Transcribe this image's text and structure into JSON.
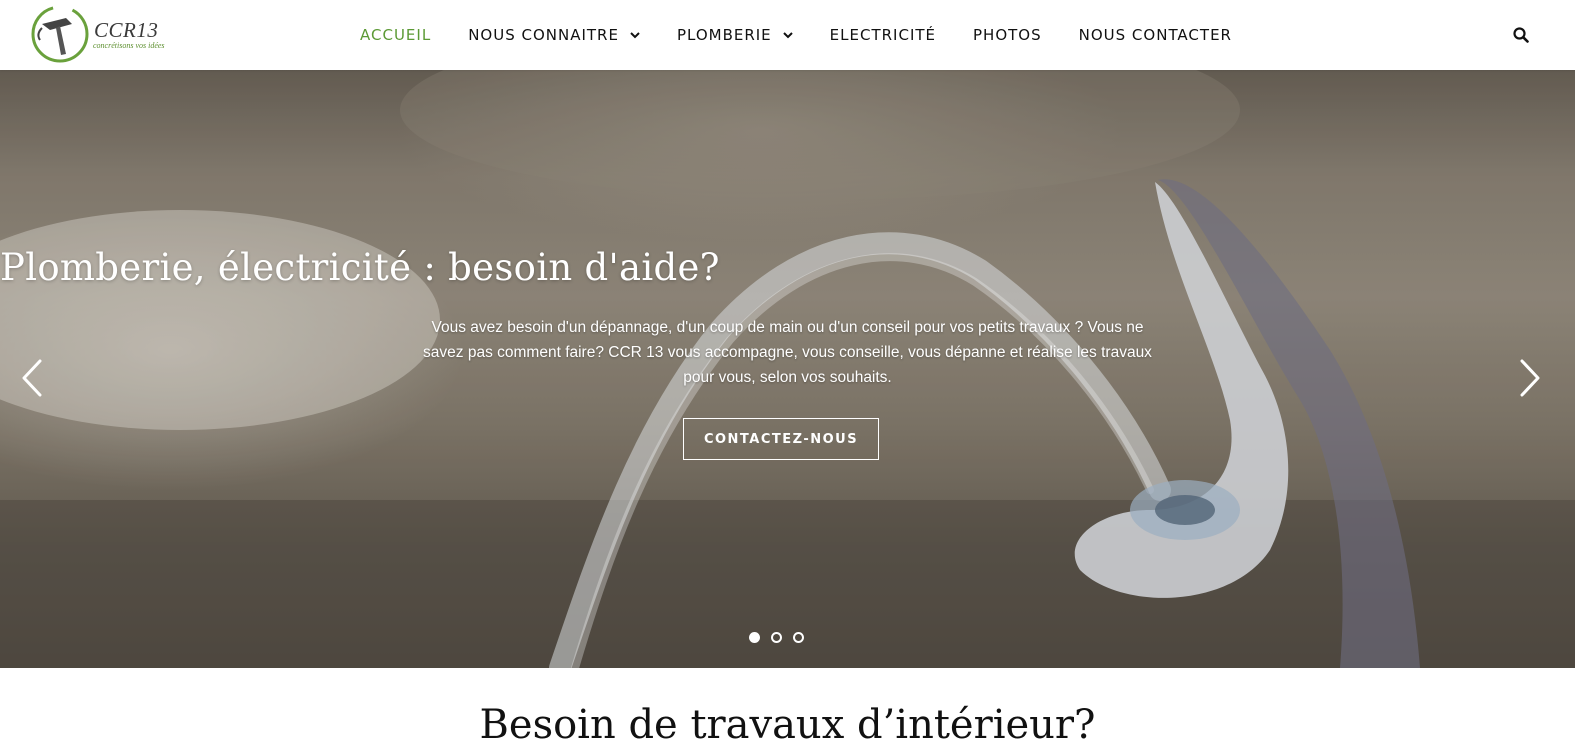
{
  "header": {
    "logo": {
      "name": "CCR13",
      "tagline": "concrétisons vos idées"
    },
    "nav": [
      {
        "label": "ACCUEIL",
        "active": true,
        "has_dropdown": false
      },
      {
        "label": "NOUS CONNAITRE",
        "active": false,
        "has_dropdown": true
      },
      {
        "label": "PLOMBERIE",
        "active": false,
        "has_dropdown": true
      },
      {
        "label": "ELECTRICITÉ",
        "active": false,
        "has_dropdown": false
      },
      {
        "label": "PHOTOS",
        "active": false,
        "has_dropdown": false
      },
      {
        "label": "NOUS CONTACTER",
        "active": false,
        "has_dropdown": false
      }
    ],
    "search_icon": "search-icon"
  },
  "hero": {
    "title": "Plomberie, électricité : besoin d'aide?",
    "text": "Vous avez besoin d'un dépannage, d'un coup de main ou d'un conseil pour vos petits travaux ? Vous ne savez pas comment faire? CCR 13 vous accompagne, vous conseille, vous dépanne et réalise les travaux pour vous, selon vos souhaits.",
    "button_label": "CONTACTEZ-NOUS",
    "prev_icon": "chevron-left-icon",
    "next_icon": "chevron-right-icon",
    "slides_total": 3,
    "active_slide": 1
  },
  "section": {
    "title": "Besoin de travaux d’intérieur?"
  },
  "colors": {
    "accent": "#5c9a35",
    "text": "#111111",
    "white": "#ffffff"
  }
}
